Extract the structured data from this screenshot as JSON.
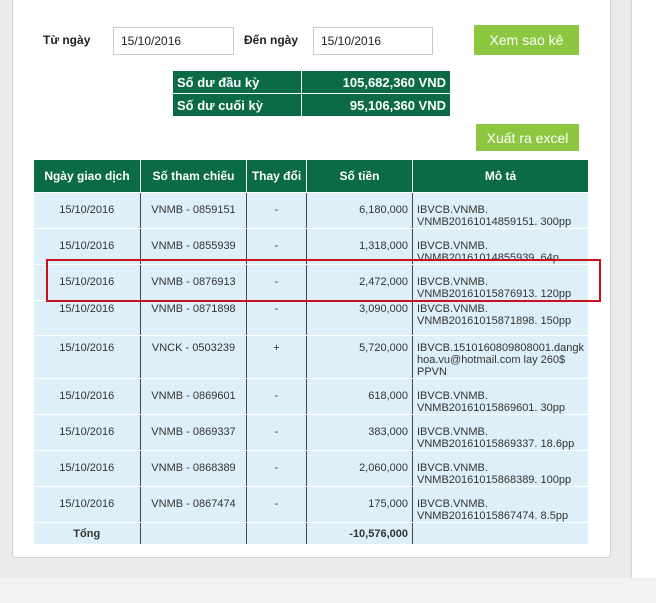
{
  "filters": {
    "from_label": "Từ ngày",
    "from_value": "15/10/2016",
    "to_label": "Đến ngày",
    "to_value": "15/10/2016",
    "view_button": "Xem sao kê",
    "export_button": "Xuất ra excel"
  },
  "balance": {
    "opening_label": "Số dư đầu kỳ",
    "opening_value": "105,682,360 VND",
    "closing_label": "Số dư cuối kỳ",
    "closing_value": "95,106,360 VND"
  },
  "table": {
    "headers": [
      "Ngày giao dịch",
      "Số tham chiếu",
      "Thay đổi",
      "Số tiền",
      "Mô tả"
    ],
    "rows": [
      {
        "date": "15/10/2016",
        "ref": "VNMB - 0859151",
        "change": "-",
        "amount": "6,180,000",
        "desc_1": "IBVCB.VNMB.",
        "desc_2": "VNMB20161014859151. 300pp",
        "desc_3": ""
      },
      {
        "date": "15/10/2016",
        "ref": "VNMB - 0855939",
        "change": "-",
        "amount": "1,318,000",
        "desc_1": "IBVCB.VNMB.",
        "desc_2": "VNMB20161014855939. 64p",
        "desc_3": ""
      },
      {
        "date": "15/10/2016",
        "ref": "VNMB - 0876913",
        "change": "-",
        "amount": "2,472,000",
        "desc_1": "IBVCB.VNMB.",
        "desc_2": "VNMB20161015876913. 120pp",
        "desc_3": ""
      },
      {
        "date": "15/10/2016",
        "ref": "VNMB - 0871898",
        "change": "-",
        "amount": "3,090,000",
        "desc_1": "IBVCB.VNMB.",
        "desc_2": "VNMB20161015871898. 150pp",
        "desc_3": ""
      },
      {
        "date": "15/10/2016",
        "ref": "VNCK - 0503239",
        "change": "+",
        "amount": "5,720,000",
        "desc_1": "IBVCB.1510160809808001.dangk",
        "desc_2": "hoa.vu@hotmail.com lay 260$",
        "desc_3": "PPVN"
      },
      {
        "date": "15/10/2016",
        "ref": "VNMB - 0869601",
        "change": "-",
        "amount": "618,000",
        "desc_1": "IBVCB.VNMB.",
        "desc_2": "VNMB20161015869601. 30pp",
        "desc_3": ""
      },
      {
        "date": "15/10/2016",
        "ref": "VNMB - 0869337",
        "change": "-",
        "amount": "383,000",
        "desc_1": "IBVCB.VNMB.",
        "desc_2": "VNMB20161015869337. 18.6pp",
        "desc_3": ""
      },
      {
        "date": "15/10/2016",
        "ref": "VNMB - 0868389",
        "change": "-",
        "amount": "2,060,000",
        "desc_1": "IBVCB.VNMB.",
        "desc_2": "VNMB20161015868389. 100pp",
        "desc_3": ""
      },
      {
        "date": "15/10/2016",
        "ref": "VNMB - 0867474",
        "change": "-",
        "amount": "175,000",
        "desc_1": "IBVCB.VNMB.",
        "desc_2": "VNMB20161015867474. 8.5pp",
        "desc_3": ""
      }
    ],
    "total_label": "Tổng",
    "total_amount": "-10,576,000"
  }
}
